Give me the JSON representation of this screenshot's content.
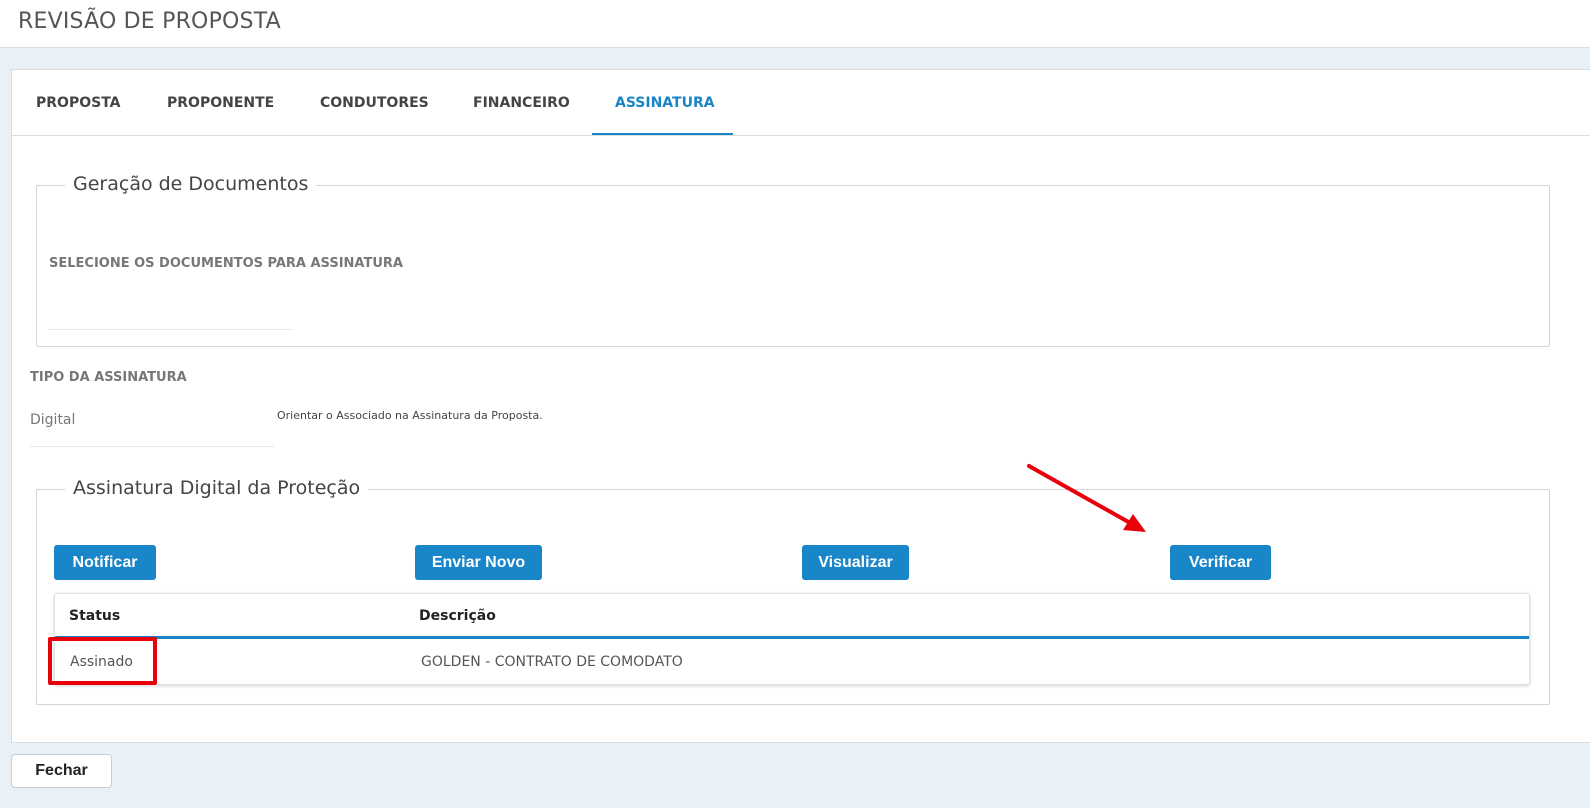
{
  "header": {
    "title": "REVISÃO DE PROPOSTA"
  },
  "tabs": [
    {
      "label": "PROPOSTA"
    },
    {
      "label": "PROPONENTE"
    },
    {
      "label": "CONDUTORES"
    },
    {
      "label": "FINANCEIRO"
    },
    {
      "label": "ASSINATURA",
      "active": true
    }
  ],
  "documents": {
    "legend": "Geração de Documentos",
    "select_label": "SELECIONE OS DOCUMENTOS PARA ASSINATURA"
  },
  "signature_type": {
    "label": "TIPO DA ASSINATURA",
    "value": "Digital",
    "hint": "Orientar o Associado na Assinatura da Proposta."
  },
  "digital_signature": {
    "legend": "Assinatura Digital da Proteção",
    "buttons": {
      "notify": "Notificar",
      "send_new": "Enviar Novo",
      "view": "Visualizar",
      "verify": "Verificar"
    },
    "table": {
      "columns": [
        "Status",
        "Descrição"
      ],
      "rows": [
        {
          "status": "Assinado",
          "description": "GOLDEN - CONTRATO DE COMODATO"
        }
      ]
    }
  },
  "footer": {
    "close_label": "Fechar"
  },
  "colors": {
    "accent": "#1a85c6",
    "button": "#1886c8",
    "annotation": "#e8000b",
    "background": "#e9f1f7"
  }
}
